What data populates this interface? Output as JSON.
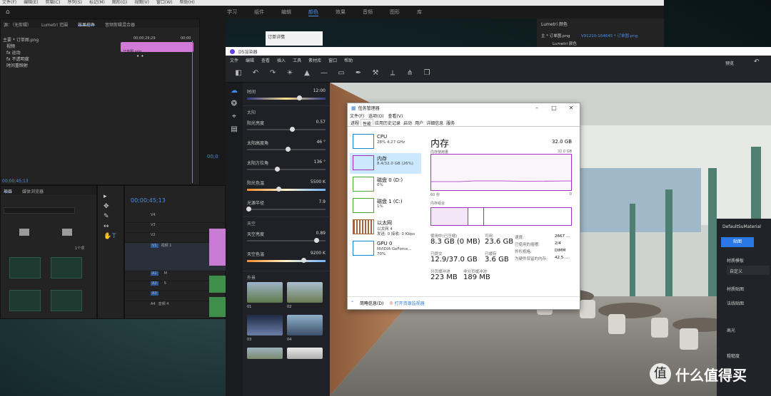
{
  "premiere": {
    "menubar": [
      "文件(F)",
      "编辑(E)",
      "剪辑(C)",
      "序列(S)",
      "标记(M)",
      "图形(G)",
      "视图(V)",
      "窗口(W)",
      "帮助(H)"
    ],
    "nav": [
      "学习",
      "组件",
      "编辑",
      "颜色",
      "效果",
      "音频",
      "图形",
      "库"
    ],
    "nav_active": "颜色",
    "effect_tabs": [
      "源：（无剪辑）",
      "Lumetri 范围",
      "效果控件",
      "音频剪辑混合器"
    ],
    "effect_tab_sel": "效果控件",
    "clip_name": "主要 * 订单图.png",
    "clip_name2": "订单图.png",
    "timecode_top": "00;00;29;29",
    "timecode_top2": "00;00",
    "ec_rows": [
      "视频",
      "fx 运动",
      "fx 不透明度",
      "时间重映射"
    ],
    "timecode_bottom": "00;00;45;13",
    "project_tabs": [
      "项目",
      "媒体浏览器"
    ],
    "project_thumb_label": "1个项",
    "program_time": "00;0",
    "tracks": [
      {
        "id": "V4",
        "lbl": ""
      },
      {
        "id": "V3",
        "lbl": ""
      },
      {
        "id": "V2",
        "lbl": ""
      },
      {
        "id": "V1",
        "lbl": "视频 1"
      },
      {
        "id": "A1",
        "lbl": ""
      },
      {
        "id": "A2",
        "lbl": ""
      },
      {
        "id": "A3",
        "lbl": ""
      },
      {
        "id": "A4",
        "lbl": "音频 4"
      }
    ],
    "track_msb": [
      "M",
      "S"
    ],
    "doc_title": "订单详情"
  },
  "lumetri": {
    "title": "Lumetri 颜色",
    "clip": "主 * 订单图.png",
    "clip2": "V91210-164645 * 订单图.png",
    "fx": "Lumetri 颜色"
  },
  "d5": {
    "title": "D5渲染器",
    "menu": [
      "文件",
      "编辑",
      "查看",
      "插入",
      "工具",
      "素材库",
      "窗口",
      "帮助"
    ],
    "preview": "预览",
    "sliders": [
      {
        "label": "时间",
        "value": "12:00",
        "pos": 0.66,
        "gradient": "time"
      },
      {
        "section": "太阳"
      },
      {
        "label": "阳光亮度",
        "value": "0.57",
        "pos": 0.57
      },
      {
        "label": "太阳高度角",
        "value": "46 °",
        "pos": 0.52
      },
      {
        "label": "太阳方位角",
        "value": "136 °",
        "pos": 0.38
      },
      {
        "label": "阳光色温",
        "value": "5500 K",
        "pos": 0.4,
        "gradient": "temp"
      },
      {
        "label": "光源半径",
        "value": "7.9",
        "pos": 0.02
      },
      {
        "section": "天空"
      },
      {
        "label": "天空亮度",
        "value": "0.89",
        "pos": 0.88
      },
      {
        "label": "天空色温",
        "value": "9200 K",
        "pos": 0.72,
        "gradient": "temp"
      }
    ],
    "env_title": "外景",
    "skies": [
      "01",
      "02",
      "03",
      "04"
    ]
  },
  "task_manager": {
    "title": "任务管理器",
    "menu": [
      "文件(F)",
      "选项(O)",
      "查看(V)"
    ],
    "tabs": [
      "进程",
      "性能",
      "应用历史记录",
      "启动",
      "用户",
      "详细信息",
      "服务"
    ],
    "tab_sel": "性能",
    "resources": [
      {
        "name": "CPU",
        "s1": "28%  4.27 GHz",
        "s2": "",
        "color": "#1a86d6"
      },
      {
        "name": "内存",
        "s1": "8.4/32.0 GB (26%)",
        "s2": "",
        "color": "#a42fc1",
        "selected": true
      },
      {
        "name": "磁盘 0 (D:)",
        "s1": "0%",
        "s2": "",
        "color": "#4ea72e"
      },
      {
        "name": "磁盘 1 (C:)",
        "s1": "1%",
        "s2": "",
        "color": "#4ea72e"
      },
      {
        "name": "以太网",
        "s1": "以太网 4",
        "s2": "发送: 0  接收: 0 Kbps",
        "color": "#a8623a"
      },
      {
        "name": "GPU 0",
        "s1": "NVIDIA GeForce...",
        "s2": "70%",
        "color": "#1a86d6"
      }
    ],
    "heading": "内存",
    "total": "32.0 GB",
    "usage_label": "内存使用量",
    "usage_max": "32.0 GB",
    "axis_left": "60 秒",
    "axis_right": "0",
    "composition_label": "内存组合",
    "stats": {
      "in_use_l": "使用中(已压缩)",
      "in_use_v": "8.3 GB (0 MB)",
      "avail_l": "可用",
      "avail_v": "23.6 GB",
      "commit_l": "已提交",
      "commit_v": "12.9/37.0 GB",
      "cached_l": "已缓存",
      "cached_v": "3.6 GB",
      "paged_l": "分页缓冲池",
      "paged_v": "223 MB",
      "nonpaged_l": "非分页缓冲池",
      "nonpaged_v": "189 MB",
      "speed_l": "速度:",
      "speed_v": "2667 ...",
      "slots_l": "已使用的插槽:",
      "slots_v": "2/4",
      "form_l": "外形规格:",
      "form_v": "DIMM",
      "hw_l": "为硬件保留的内存:",
      "hw_v": "42.5 ..."
    },
    "footer_brief": "简略信息(D)",
    "footer_monitor": "打开资源监视器"
  },
  "material": {
    "title": "DefaultSuMaterial",
    "tab": "贴图",
    "template_l": "材质模板",
    "template_v": "自定义",
    "map_l": "材质贴图",
    "normal_l": "法线贴图",
    "spec_l": "高光",
    "rough_l": "粗糙度"
  },
  "watermark": "什么值得买"
}
